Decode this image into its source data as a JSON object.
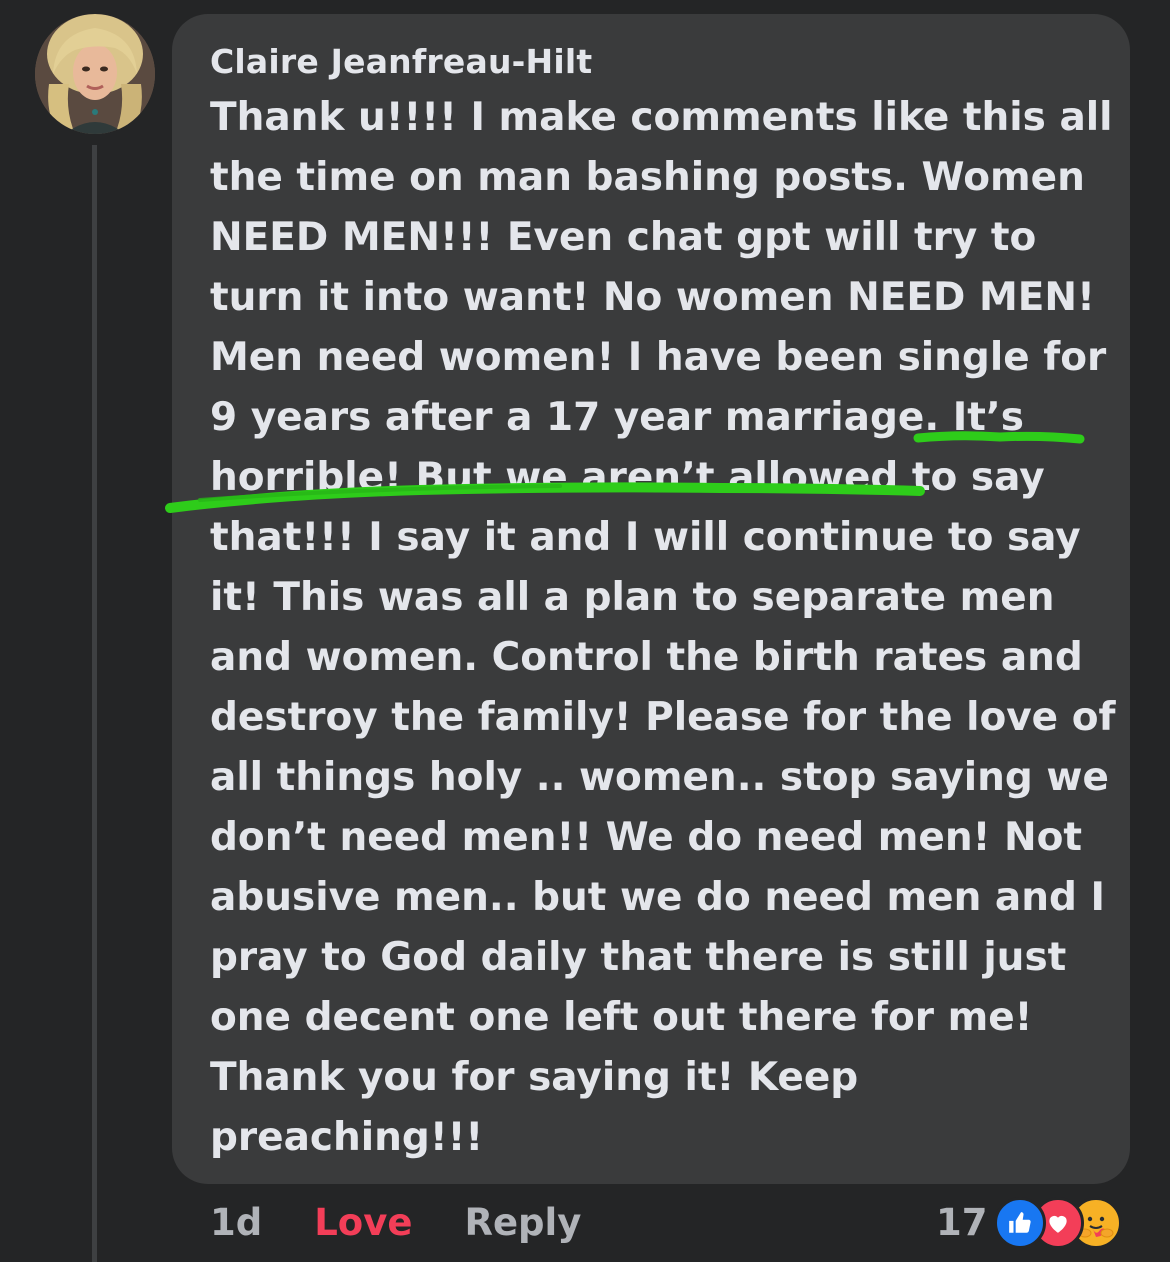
{
  "comment": {
    "author": "Claire Jeanfreau-Hilt",
    "lines": [
      "Thank u!!!! I make comments like this all",
      "the time on man bashing posts. Women",
      "NEED MEN!!! Even chat gpt will try to",
      "turn it into want! No women NEED MEN!",
      "Men need women! I have been single for",
      "9 years after a 17 year marriage. It’s",
      "horrible! But we aren’t allowed to say",
      "that!!! I say it and I will continue to say",
      "it! This was all a plan to separate men",
      "and women. Control the birth rates and",
      "destroy the family! Please for the love of",
      "all things holy .. women.. stop saying we",
      "don’t need men!! We do need men! Not",
      "abusive men.. but we do need men and I",
      "pray to God daily that there is still just",
      "one decent one left out there for me!",
      "Thank you for saying it! Keep",
      "preaching!!!"
    ],
    "highlight_color": "#2ecc1a"
  },
  "actions": {
    "timestamp": "1d",
    "reaction_label": "Love",
    "reply_label": "Reply"
  },
  "reactions": {
    "count": "17",
    "icons": [
      "like-icon",
      "heart-icon",
      "care-icon"
    ]
  },
  "colors": {
    "background": "#242526",
    "bubble": "#3a3b3c",
    "text": "#e4e6eb",
    "secondary_text": "#b0b3b8",
    "love_red": "#f33e58",
    "like_blue": "#1877f2"
  }
}
